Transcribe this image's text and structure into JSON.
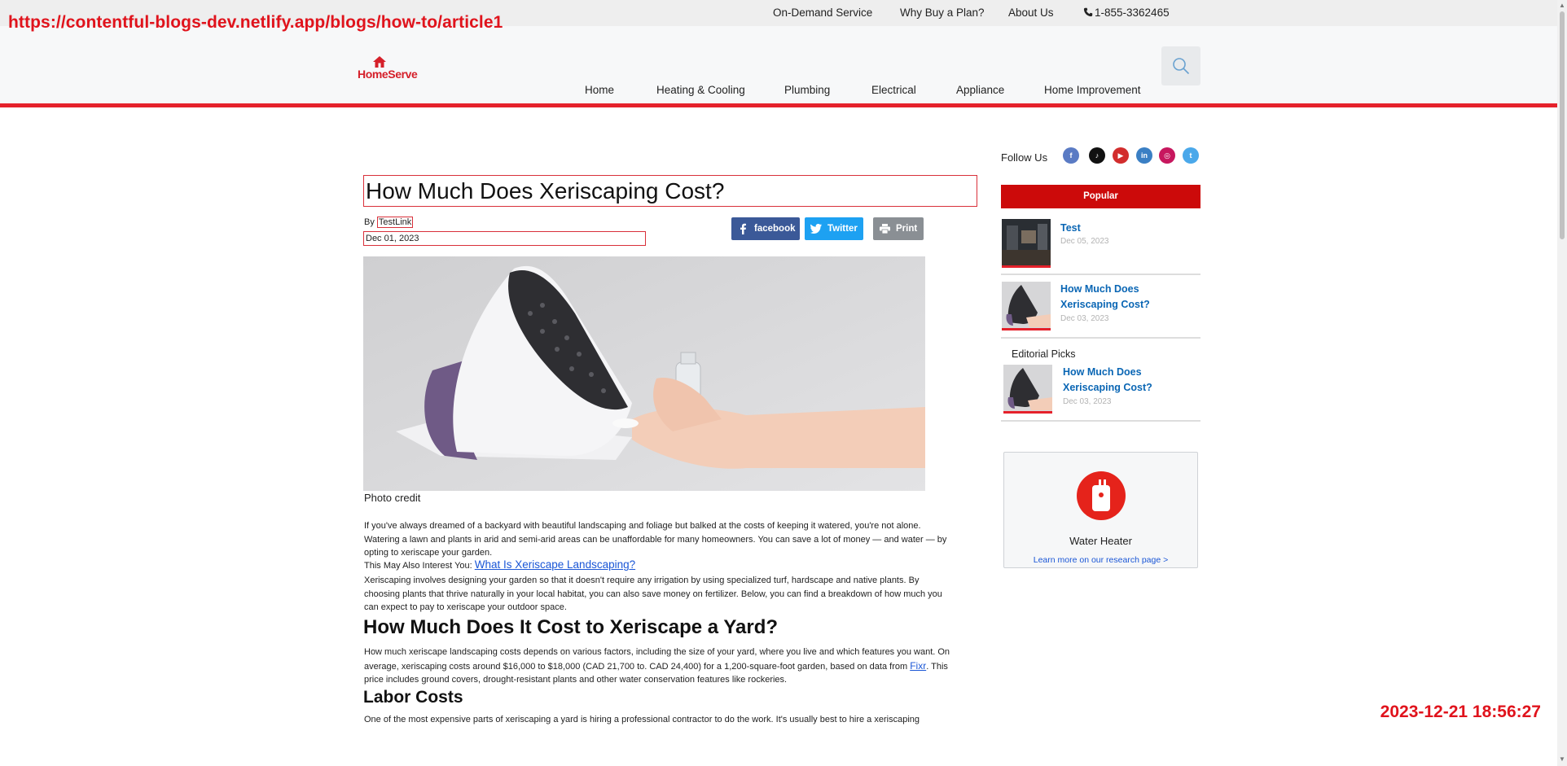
{
  "overlay": {
    "url": "https://contentful-blogs-dev.netlify.app/blogs/how-to/article1",
    "timestamp": "2023-12-21 18:56:27"
  },
  "utility_nav": {
    "on_demand": "On-Demand Service",
    "why_buy": "Why Buy a Plan?",
    "about": "About Us",
    "phone": "1-855-3362465"
  },
  "logo_text": "HomeServe",
  "nav": [
    "Home",
    "Heating & Cooling",
    "Plumbing",
    "Electrical",
    "Appliance",
    "Home Improvement"
  ],
  "article": {
    "title": "How Much Does Xeriscaping Cost?",
    "by_prefix": "By",
    "author": "TestLink",
    "date": "Dec 01, 2023",
    "share": {
      "facebook": "facebook",
      "twitter": "Twitter",
      "print": "Print"
    },
    "photo_credit": "Photo credit",
    "p1": "If you've always dreamed of a backyard with beautiful landscaping and foliage but balked at the costs of keeping it watered, you're not alone. Watering a lawn and plants in arid and semi-arid areas can be unaffordable for many homeowners. You can save a lot of money — and water — by opting to xeriscape your garden.",
    "also_prefix": "This May Also Interest You:",
    "also_link": "What Is Xeriscape Landscaping?",
    "p2": "Xeriscaping involves designing your garden so that it doesn't require any irrigation by using specialized turf, hardscape and native plants. By choosing plants that thrive naturally in your local habitat, you can also save money on fertilizer. Below, you can find a breakdown of how much you can expect to pay to xeriscape your outdoor space.",
    "h2": "How Much Does It Cost to Xeriscape a Yard?",
    "p3_before": "How much xeriscape landscaping costs depends on various factors, including the size of your yard, where you live and which features you want. On average, xeriscaping costs around $16,000 to $18,000 (CAD 21,700 to. CAD 24,400) for a 1,200-square-foot garden, based on data from ",
    "p3_link": "Fixr",
    "p3_after": ". This price includes ground covers, drought-resistant plants and other water conservation features like rockeries.",
    "h3": "Labor Costs",
    "p4": "One of the most expensive parts of xeriscaping a yard is hiring a professional contractor to do the work. It's usually best to hire a xeriscaping"
  },
  "sidebar": {
    "follow_us": "Follow Us",
    "social_icons": [
      "facebook-icon",
      "tiktok-icon",
      "youtube-icon",
      "linkedin-icon",
      "instagram-icon",
      "twitter-icon"
    ],
    "popular_label": "Popular",
    "popular": [
      {
        "title": "Test",
        "date": "Dec 05, 2023"
      },
      {
        "title": "How Much Does Xeriscaping Cost?",
        "date": "Dec 03, 2023"
      }
    ],
    "editorial_label": "Editorial Picks",
    "editorial": [
      {
        "title": "How Much Does Xeriscaping Cost?",
        "date": "Dec 03, 2023"
      }
    ],
    "promo_label": "Water Heater",
    "promo_link": "Learn more on our research page >"
  },
  "colors": {
    "brand_red": "#e5212b",
    "popular_bg": "#cc0a0a",
    "link_blue": "#0a66b4",
    "facebook": "#3b5998",
    "twitter": "#1da1f2",
    "print": "#8a8f94"
  }
}
